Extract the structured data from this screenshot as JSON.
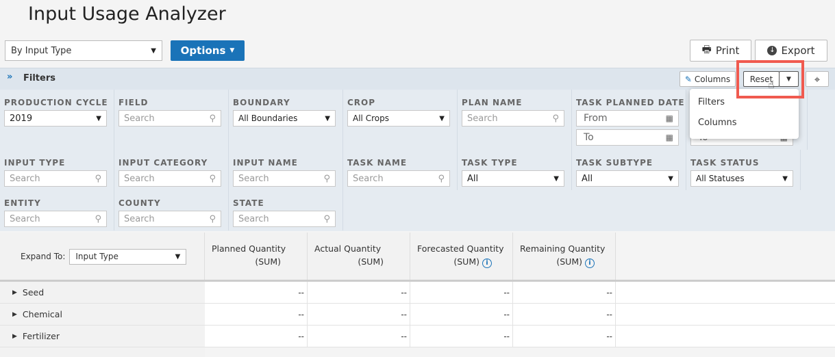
{
  "title": "Input Usage Analyzer",
  "view_select": "By Input Type",
  "options_label": "Options",
  "print_label": "Print",
  "export_label": "Export",
  "filters_label": "Filters",
  "columns_label": "Columns",
  "reset_label": "Reset",
  "reset_menu": [
    "Filters",
    "Columns"
  ],
  "filters": {
    "production_cycle": {
      "label": "PRODUCTION CYCLE",
      "value": "2019"
    },
    "field": {
      "label": "FIELD",
      "placeholder": "Search"
    },
    "boundary": {
      "label": "BOUNDARY",
      "value": "All Boundaries"
    },
    "crop": {
      "label": "CROP",
      "value": "All Crops"
    },
    "plan_name": {
      "label": "PLAN NAME",
      "placeholder": "Search"
    },
    "task_planned_date": {
      "label": "TASK PLANNED DATE",
      "from": "From",
      "to": "To"
    },
    "hidden_date_to": "To",
    "input_type": {
      "label": "INPUT TYPE",
      "placeholder": "Search"
    },
    "input_category": {
      "label": "INPUT CATEGORY",
      "placeholder": "Search"
    },
    "input_name": {
      "label": "INPUT NAME",
      "placeholder": "Search"
    },
    "task_name": {
      "label": "TASK NAME",
      "placeholder": "Search"
    },
    "task_type": {
      "label": "TASK TYPE",
      "value": "All"
    },
    "task_subtype": {
      "label": "TASK SUBTYPE",
      "value": "All"
    },
    "task_status": {
      "label": "TASK STATUS",
      "value": "All Statuses"
    },
    "entity": {
      "label": "ENTITY",
      "placeholder": "Search"
    },
    "county": {
      "label": "COUNTY",
      "placeholder": "Search"
    },
    "state": {
      "label": "STATE",
      "placeholder": "Search"
    }
  },
  "table": {
    "expand_label": "Expand To:",
    "expand_value": "Input Type",
    "columns": [
      {
        "name": "Planned Quantity",
        "agg": "(SUM)",
        "info": false
      },
      {
        "name": "Actual Quantity",
        "agg": "(SUM)",
        "info": false
      },
      {
        "name": "Forecasted Quantity",
        "agg": "(SUM)",
        "info": true
      },
      {
        "name": "Remaining Quantity",
        "agg": "(SUM)",
        "info": true
      }
    ],
    "rows": [
      {
        "label": "Seed",
        "values": [
          "--",
          "--",
          "--",
          "--"
        ]
      },
      {
        "label": "Chemical",
        "values": [
          "--",
          "--",
          "--",
          "--"
        ]
      },
      {
        "label": "Fertilizer",
        "values": [
          "--",
          "--",
          "--",
          "--"
        ]
      }
    ]
  },
  "colors": {
    "primary": "#1a73b8",
    "highlight": "#f05a4f"
  }
}
